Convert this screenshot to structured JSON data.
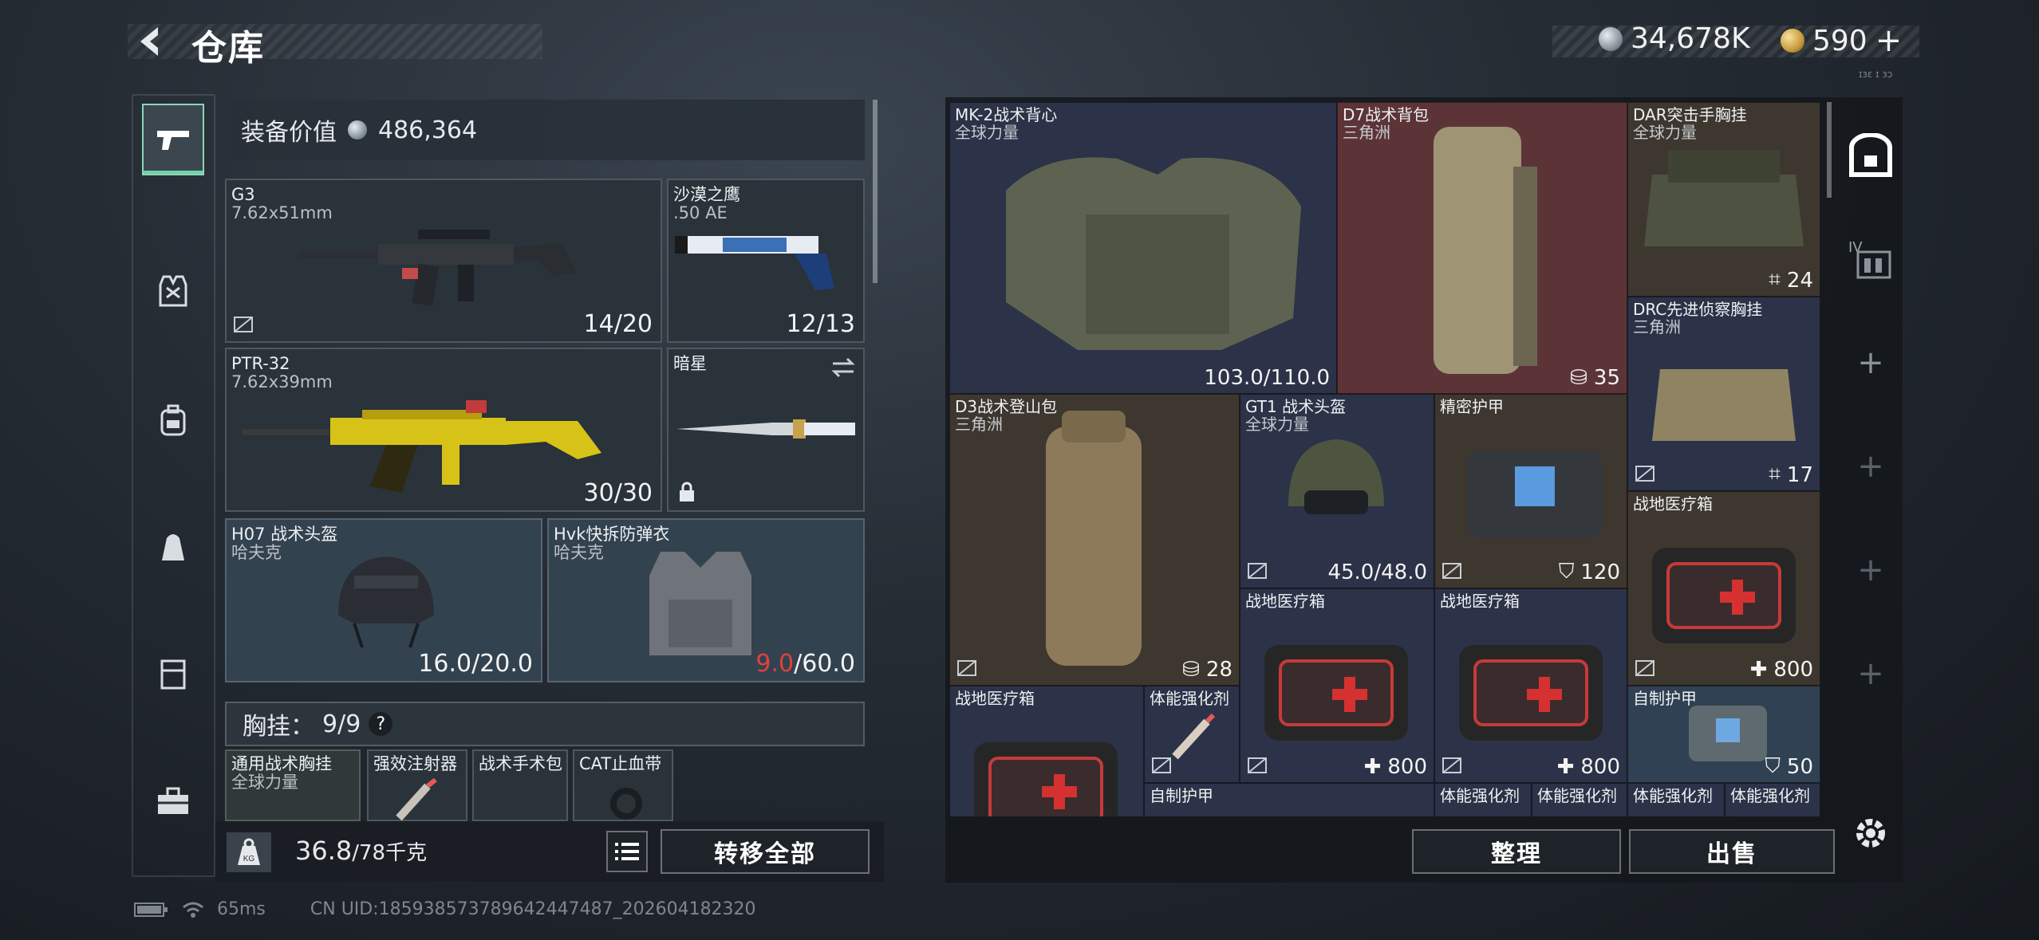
{
  "header": {
    "title": "仓库",
    "silver_amount": "34,678K",
    "gold_amount": "590",
    "plus": "+",
    "tiny_label": "ɪɜɛ ɪ ɜɔ"
  },
  "equipment": {
    "value_label": "装备价值",
    "value": "486,364",
    "primary1": {
      "name": "G3",
      "caliber": "7.62x51mm",
      "ammo": "14/20"
    },
    "pistol": {
      "name": "沙漠之鹰",
      "caliber": ".50 AE",
      "ammo": "12/13"
    },
    "primary2": {
      "name": "PTR-32",
      "caliber": "7.62x39mm",
      "ammo": "30/30"
    },
    "melee": {
      "name": "暗星"
    },
    "helmet": {
      "name": "H07 战术头盔",
      "brand": "哈夫克",
      "durability": "16.0/20.0"
    },
    "armor": {
      "name": "Hvk快拆防弹衣",
      "brand": "哈夫克",
      "durability_cur": "9.0",
      "durability_max": "/60.0"
    },
    "chest": {
      "label": "胸挂：",
      "count": "9/9",
      "help": "?"
    },
    "chest_items": [
      "通用战术胸挂",
      "强效注射器",
      "战术手术包",
      "CAT止血带"
    ],
    "chest_item1_brand": "全球力量",
    "weight": {
      "current": "36.8",
      "max": "/78千克",
      "badge": "KG"
    },
    "transfer_all": "转移全部"
  },
  "inventory": {
    "items": [
      {
        "name": "MK-2战术背心",
        "brand": "全球力量",
        "val": "103.0/110.0"
      },
      {
        "name": "D7战术背包",
        "brand": "三角洲",
        "val": "35"
      },
      {
        "name": "DAR突击手胸挂",
        "brand": "全球力量",
        "val": "24"
      },
      {
        "name": "DRC先进侦察胸挂",
        "brand": "三角洲",
        "val": "17"
      },
      {
        "name": "D3战术登山包",
        "brand": "三角洲",
        "val": "28"
      },
      {
        "name": "GT1 战术头盔",
        "brand": "全球力量",
        "val": "45.0/48.0"
      },
      {
        "name": "精密护甲",
        "brand": "",
        "val": "120"
      },
      {
        "name": "战地医疗箱",
        "brand": "",
        "val": "800"
      },
      {
        "name": "战地医疗箱",
        "brand": "",
        "val": "800"
      },
      {
        "name": "战地医疗箱",
        "brand": "",
        "val": "800"
      },
      {
        "name": "战地医疗箱",
        "brand": "",
        "val": ""
      },
      {
        "name": "体能强化剂",
        "brand": "",
        "val": ""
      },
      {
        "name": "自制护甲",
        "brand": "",
        "val": "50"
      },
      {
        "name": "自制护甲",
        "brand": "",
        "val": ""
      },
      {
        "name": "体能强化剂",
        "brand": "",
        "val": ""
      },
      {
        "name": "体能强化剂",
        "brand": "",
        "val": ""
      },
      {
        "name": "体能强化剂",
        "brand": "",
        "val": ""
      },
      {
        "name": "体能强化剂",
        "brand": "",
        "val": ""
      }
    ],
    "sort_button": "整理",
    "sell_button": "出售",
    "tier_badge": "IV"
  },
  "status": {
    "ping": "65ms",
    "uid": "CN UID:18593857378964244748​7_202604182320"
  },
  "icons": [
    "back-arrow-icon",
    "silver-coin-icon",
    "gold-coin-icon",
    "pistol-icon",
    "vest-icon",
    "backpack-icon",
    "pouch-icon",
    "case-icon",
    "toolbox-icon",
    "safe-icon",
    "settings-icon",
    "battery-icon",
    "wifi-icon"
  ]
}
